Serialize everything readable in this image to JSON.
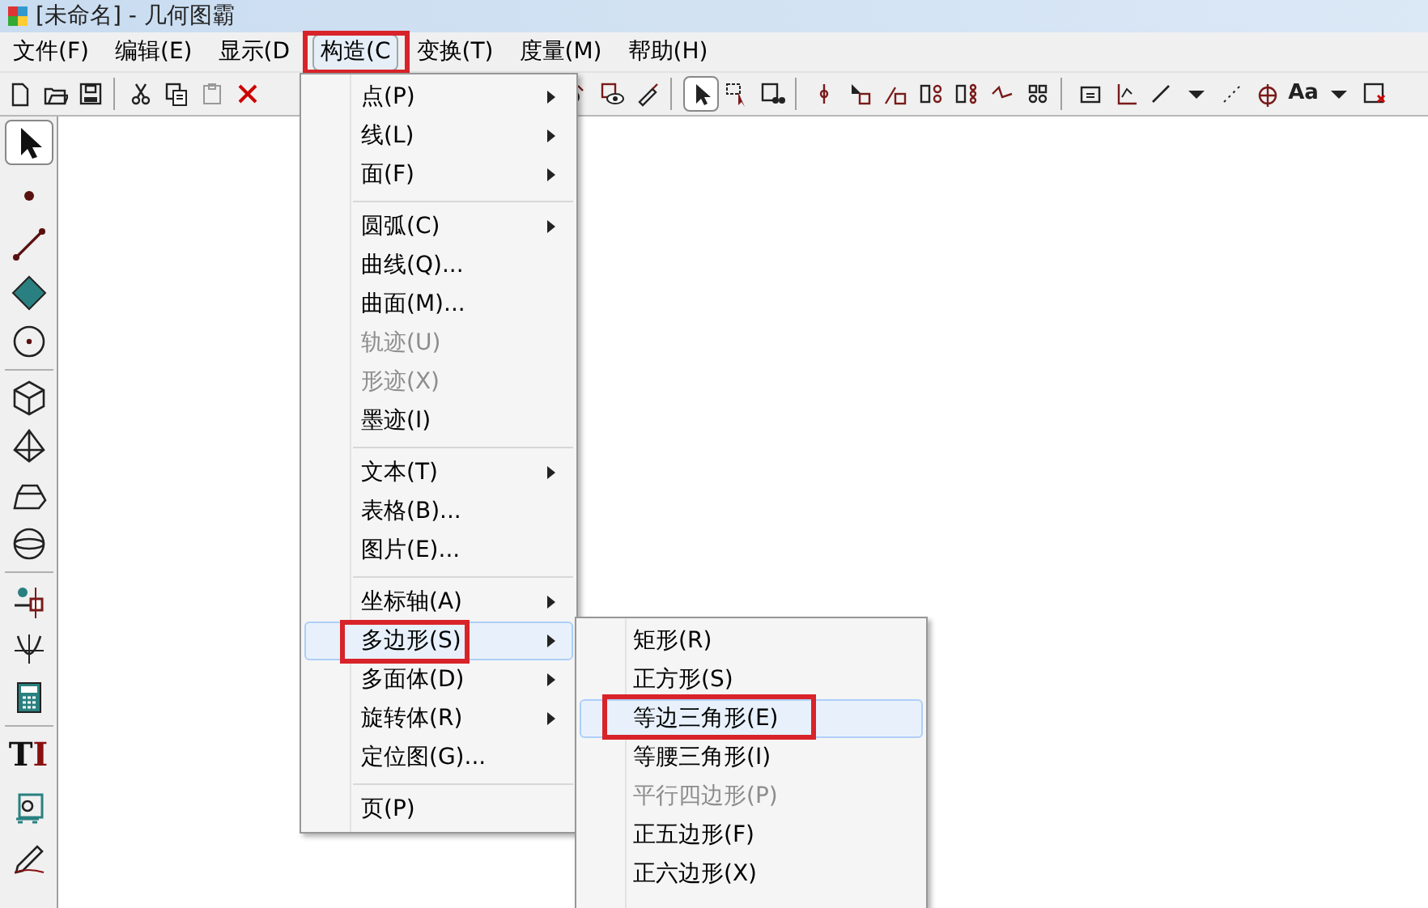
{
  "window": {
    "title": "[未命名] - 几何图霸"
  },
  "menubar": [
    {
      "label": "文件(F)",
      "selected": false,
      "annotated": false
    },
    {
      "label": "编辑(E)",
      "selected": false,
      "annotated": false
    },
    {
      "label": "显示(D",
      "selected": false,
      "annotated": false
    },
    {
      "label": "构造(C",
      "selected": true,
      "annotated": true
    },
    {
      "label": "变换(T)",
      "selected": false,
      "annotated": false
    },
    {
      "label": "度量(M)",
      "selected": false,
      "annotated": false
    },
    {
      "label": "帮助(H)",
      "selected": false,
      "annotated": false
    }
  ],
  "toolbar": {
    "font_button": "Aa"
  },
  "left_toolbar": {
    "text_tool": {
      "letter_1": "T",
      "letter_2": "I"
    }
  },
  "construct_menu": [
    {
      "kind": "item",
      "label": "点(P)",
      "has_submenu": true,
      "disabled": false,
      "selected": false,
      "annotated": false
    },
    {
      "kind": "item",
      "label": "线(L)",
      "has_submenu": true,
      "disabled": false,
      "selected": false,
      "annotated": false
    },
    {
      "kind": "item",
      "label": "面(F)",
      "has_submenu": true,
      "disabled": false,
      "selected": false,
      "annotated": false
    },
    {
      "kind": "separator"
    },
    {
      "kind": "item",
      "label": "圆弧(C)",
      "has_submenu": true,
      "disabled": false,
      "selected": false,
      "annotated": false
    },
    {
      "kind": "item",
      "label": "曲线(Q)...",
      "has_submenu": false,
      "disabled": false,
      "selected": false,
      "annotated": false
    },
    {
      "kind": "item",
      "label": "曲面(M)...",
      "has_submenu": false,
      "disabled": false,
      "selected": false,
      "annotated": false
    },
    {
      "kind": "item",
      "label": "轨迹(U)",
      "has_submenu": false,
      "disabled": true,
      "selected": false,
      "annotated": false
    },
    {
      "kind": "item",
      "label": "形迹(X)",
      "has_submenu": false,
      "disabled": true,
      "selected": false,
      "annotated": false
    },
    {
      "kind": "item",
      "label": "墨迹(I)",
      "has_submenu": false,
      "disabled": false,
      "selected": false,
      "annotated": false
    },
    {
      "kind": "separator"
    },
    {
      "kind": "item",
      "label": "文本(T)",
      "has_submenu": true,
      "disabled": false,
      "selected": false,
      "annotated": false
    },
    {
      "kind": "item",
      "label": "表格(B)...",
      "has_submenu": false,
      "disabled": false,
      "selected": false,
      "annotated": false
    },
    {
      "kind": "item",
      "label": "图片(E)...",
      "has_submenu": false,
      "disabled": false,
      "selected": false,
      "annotated": false
    },
    {
      "kind": "separator"
    },
    {
      "kind": "item",
      "label": "坐标轴(A)",
      "has_submenu": true,
      "disabled": false,
      "selected": false,
      "annotated": false
    },
    {
      "kind": "item",
      "label": "多边形(S)",
      "has_submenu": true,
      "disabled": false,
      "selected": true,
      "annotated": true
    },
    {
      "kind": "item",
      "label": "多面体(D)",
      "has_submenu": true,
      "disabled": false,
      "selected": false,
      "annotated": false
    },
    {
      "kind": "item",
      "label": "旋转体(R)",
      "has_submenu": true,
      "disabled": false,
      "selected": false,
      "annotated": false
    },
    {
      "kind": "item",
      "label": "定位图(G)...",
      "has_submenu": false,
      "disabled": false,
      "selected": false,
      "annotated": false
    },
    {
      "kind": "separator"
    },
    {
      "kind": "item",
      "label": "页(P)",
      "has_submenu": false,
      "disabled": false,
      "selected": false,
      "annotated": false
    }
  ],
  "polygon_submenu": [
    {
      "label": "矩形(R)",
      "disabled": false,
      "selected": false,
      "annotated": false
    },
    {
      "label": "正方形(S)",
      "disabled": false,
      "selected": false,
      "annotated": false
    },
    {
      "label": "等边三角形(E)",
      "disabled": false,
      "selected": true,
      "annotated": true
    },
    {
      "label": "等腰三角形(I)",
      "disabled": false,
      "selected": false,
      "annotated": false
    },
    {
      "label": "平行四边形(P)",
      "disabled": true,
      "selected": false,
      "annotated": false
    },
    {
      "label": "正五边形(F)",
      "disabled": false,
      "selected": false,
      "annotated": false
    },
    {
      "label": "正六边形(X)",
      "disabled": false,
      "selected": false,
      "annotated": false
    }
  ]
}
